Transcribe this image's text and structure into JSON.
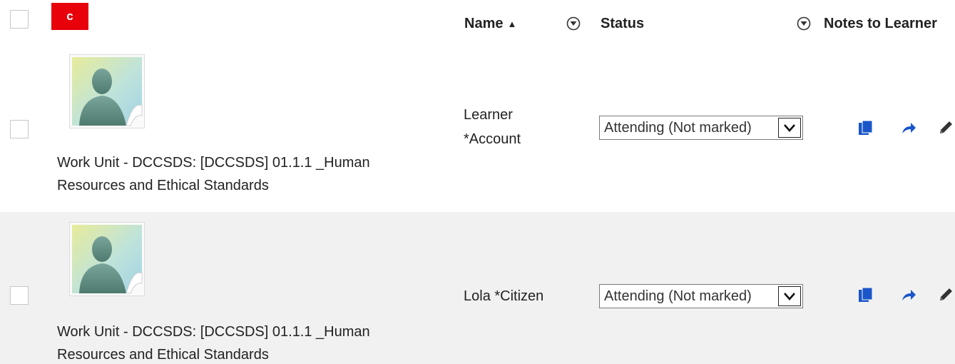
{
  "header": {
    "badge_text": "c",
    "columns": {
      "name": {
        "label": "Name",
        "sort_indicator": "▲"
      },
      "status": {
        "label": "Status"
      },
      "notes": {
        "label": "Notes to Learner"
      }
    }
  },
  "rows": [
    {
      "unit_line1": "Work Unit - DCCSDS: [DCCSDS] 01.1.1 _Human",
      "unit_line2": "Resources and Ethical Standards",
      "name_line1": "Learner",
      "name_line2": "*Account",
      "status": "Attending (Not marked)"
    },
    {
      "unit_line1": "Work Unit - DCCSDS: [DCCSDS] 01.1.1 _Human",
      "unit_line2": "Resources and Ethical Standards",
      "name_line1": "Lola *Citizen",
      "name_line2": "",
      "status": "Attending (Not marked)"
    }
  ],
  "colors": {
    "badge": "#e8000b",
    "action_blue": "#1a56c9",
    "row_alt": "#f1f1f1"
  },
  "icons": [
    "filter-icon",
    "copy-icon",
    "share-arrow-icon",
    "pencil-icon",
    "avatar-placeholder-icon",
    "chevron-down-icon"
  ]
}
